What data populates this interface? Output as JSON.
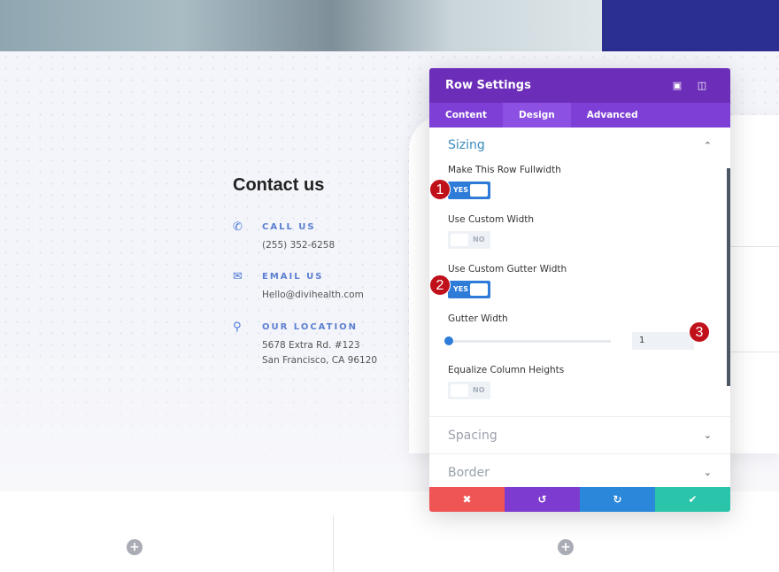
{
  "contact": {
    "title": "Contact us",
    "items": [
      {
        "icon": "phone-icon",
        "label": "CALL US",
        "lines": [
          "(255) 352-6258"
        ]
      },
      {
        "icon": "envelope-icon",
        "label": "EMAIL US",
        "lines": [
          "Hello@divihealth.com"
        ]
      },
      {
        "icon": "map-pin-icon",
        "label": "OUR LOCATION",
        "lines": [
          "5678 Extra Rd. #123",
          "San Francisco, CA 96120"
        ]
      }
    ]
  },
  "modal": {
    "title": "Row Settings",
    "tabs": [
      "Content",
      "Design",
      "Advanced"
    ],
    "active_tab": "Design",
    "section": "Sizing",
    "fields": {
      "fullwidth": {
        "label": "Make This Row Fullwidth",
        "value": "YES"
      },
      "custom_width": {
        "label": "Use Custom Width",
        "value": "NO"
      },
      "gutter_toggle": {
        "label": "Use Custom Gutter Width",
        "value": "YES"
      },
      "gutter_width": {
        "label": "Gutter Width",
        "value": "1"
      },
      "equalize": {
        "label": "Equalize Column Heights",
        "value": "NO"
      }
    },
    "collapsed": [
      "Spacing",
      "Border"
    ],
    "footer_colors": {
      "cancel": "#ef5555",
      "undo": "#7e3bd0",
      "redo": "#2b87da",
      "save": "#29c4a9"
    }
  },
  "badges": [
    "1",
    "2",
    "3"
  ],
  "plus": "+"
}
